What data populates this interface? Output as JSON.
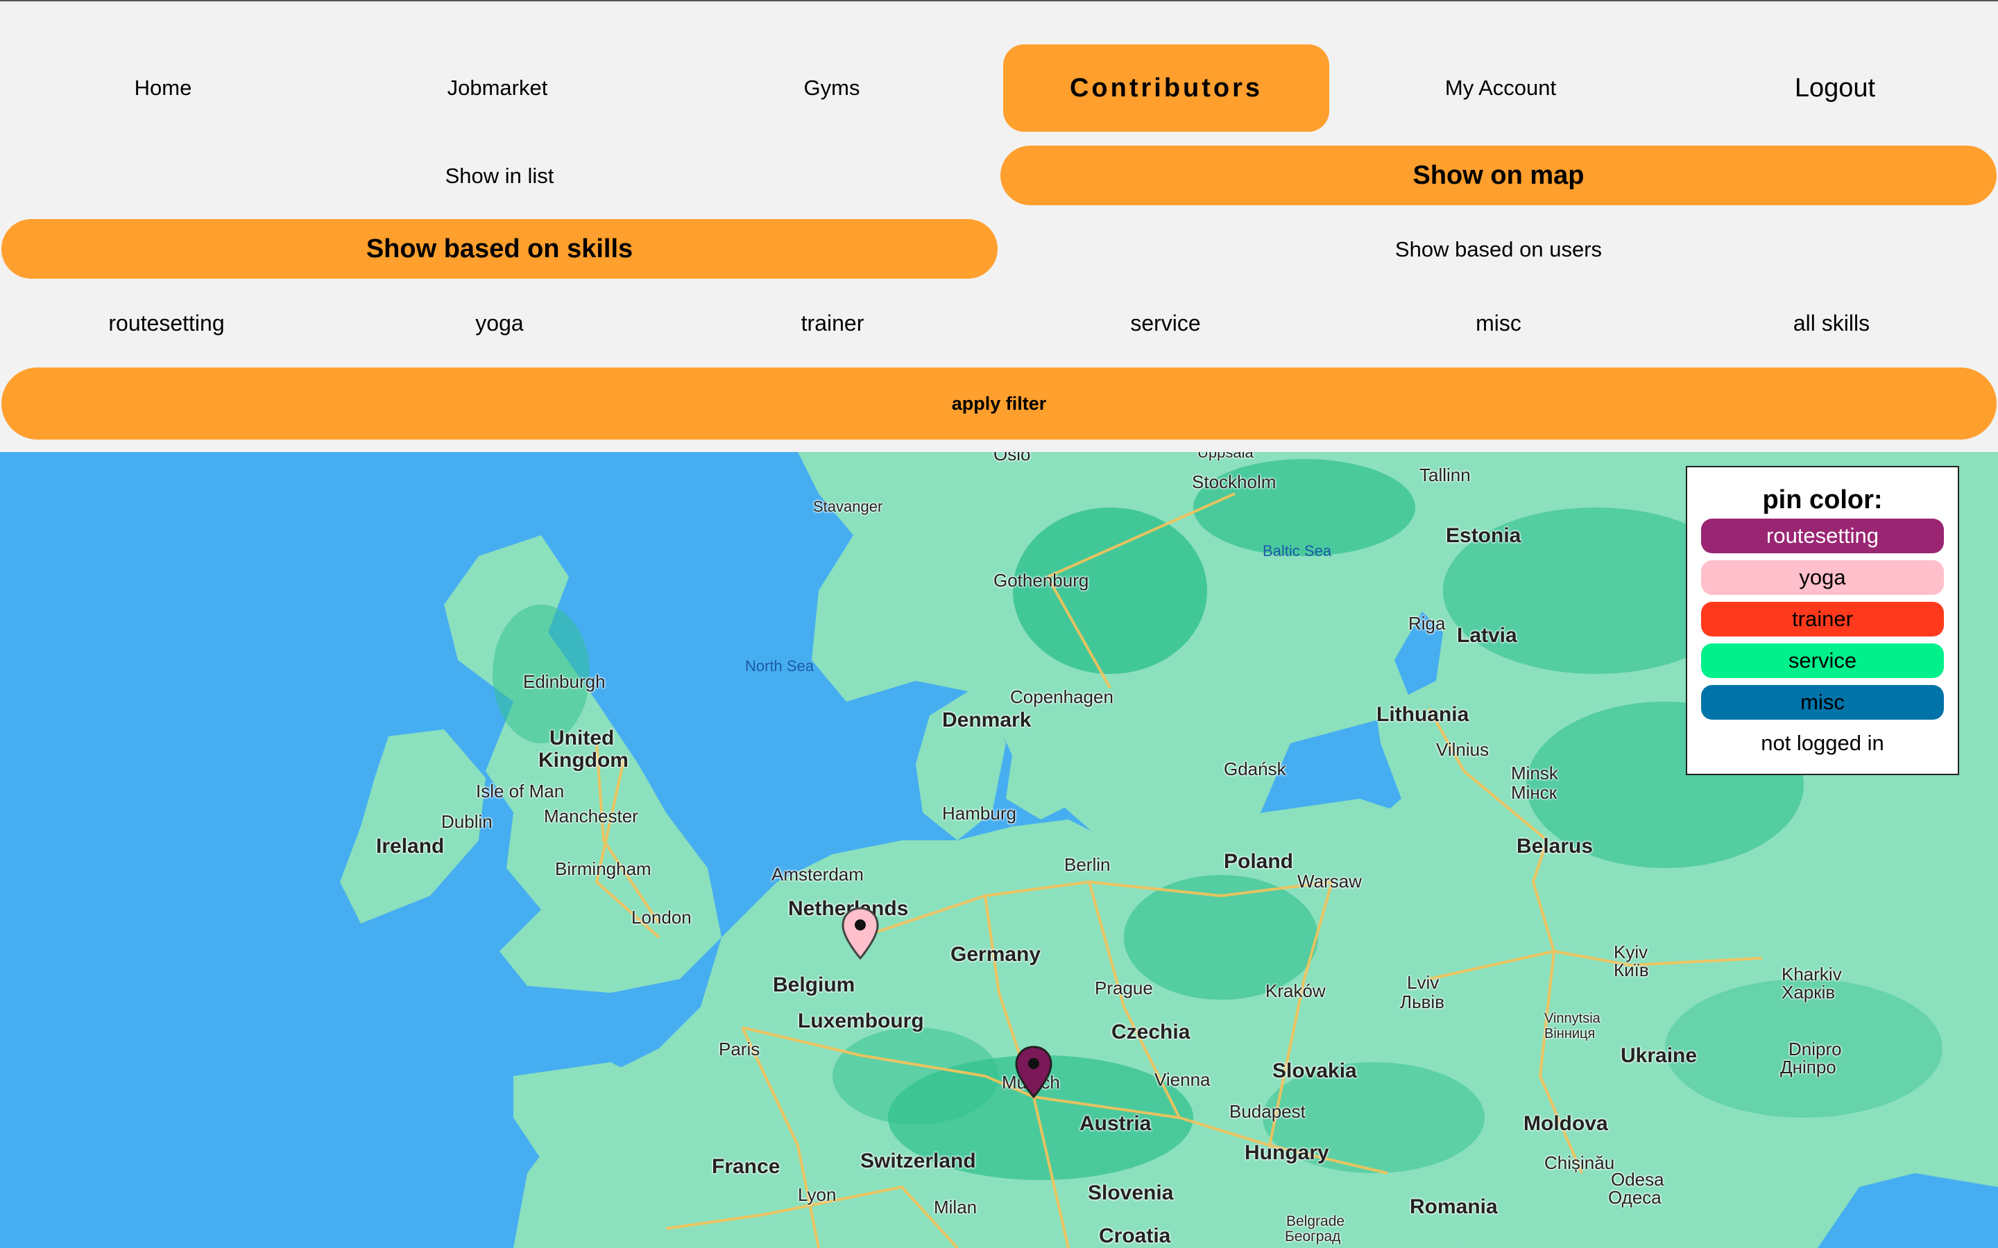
{
  "nav": {
    "items": [
      {
        "label": "Home"
      },
      {
        "label": "Jobmarket"
      },
      {
        "label": "Gyms"
      },
      {
        "label": "Contributors"
      },
      {
        "label": "My Account"
      },
      {
        "label": "Logout"
      }
    ],
    "active": "Contributors"
  },
  "view_toggle": {
    "list_label": "Show in list",
    "map_label": "Show on map",
    "active": "Show on map"
  },
  "mode_toggle": {
    "skills_label": "Show based on skills",
    "users_label": "Show based on users",
    "active": "Show based on skills"
  },
  "skills": [
    {
      "label": "routesetting"
    },
    {
      "label": "yoga"
    },
    {
      "label": "trainer"
    },
    {
      "label": "service"
    },
    {
      "label": "misc"
    },
    {
      "label": "all skills"
    }
  ],
  "apply_filter_label": "apply filter",
  "legend": {
    "title": "pin color:",
    "items": [
      {
        "label": "routesetting",
        "color": "#9a2673",
        "text_color": "#ffffff"
      },
      {
        "label": "yoga",
        "color": "#ffc0cb",
        "text_color": "#000000"
      },
      {
        "label": "trainer",
        "color": "#ff3a1c",
        "text_color": "#000000"
      },
      {
        "label": "service",
        "color": "#00f08c",
        "text_color": "#000000"
      },
      {
        "label": "misc",
        "color": "#0073a8",
        "text_color": "#000000"
      }
    ],
    "not_logged_in": "not logged in"
  },
  "map": {
    "colors": {
      "water": "#46aef0",
      "land": "#8be0bd",
      "forest": "#2fc08e",
      "road": "#f7c25a"
    },
    "labels": {
      "countries": [
        "Ireland",
        "United",
        "Kingdom",
        "Denmark",
        "Netherlands",
        "Belgium",
        "Luxembourg",
        "Germany",
        "France",
        "Switzerland",
        "Austria",
        "Czechia",
        "Slovakia",
        "Hungary",
        "Slovenia",
        "Croatia",
        "Poland",
        "Lithuania",
        "Latvia",
        "Estonia",
        "Belarus",
        "Ukraine",
        "Moldova",
        "Romania"
      ],
      "cities": [
        "Oslo",
        "Uppsala",
        "Stockholm",
        "Tallinn",
        "Stavanger",
        "Gothenburg",
        "Riga",
        "Edinburgh",
        "Copenhagen",
        "Isle of Man",
        "Dublin",
        "Manchester",
        "Birmingham",
        "London",
        "Amsterdam",
        "Hamburg",
        "Berlin",
        "Gdańsk",
        "Warsaw",
        "Vilnius",
        "Minsk",
        "Мінск",
        "Paris",
        "Prague",
        "Kraków",
        "Lviv",
        "Львів",
        "Kyiv",
        "Київ",
        "Kharkiv",
        "Харків",
        "Vinnytsia",
        "Вінниця",
        "Dnipro",
        "Дніпро",
        "Munich",
        "Vienna",
        "Budapest",
        "Lyon",
        "Milan",
        "Chișinău",
        "Odesa",
        "Одеса",
        "Belgrade",
        "Београд"
      ],
      "seas": [
        "North Sea",
        "Baltic Sea"
      ]
    },
    "pins": [
      {
        "skill": "yoga",
        "color": "#ffc0cb"
      },
      {
        "skill": "routesetting",
        "color": "#7a1858"
      }
    ]
  }
}
